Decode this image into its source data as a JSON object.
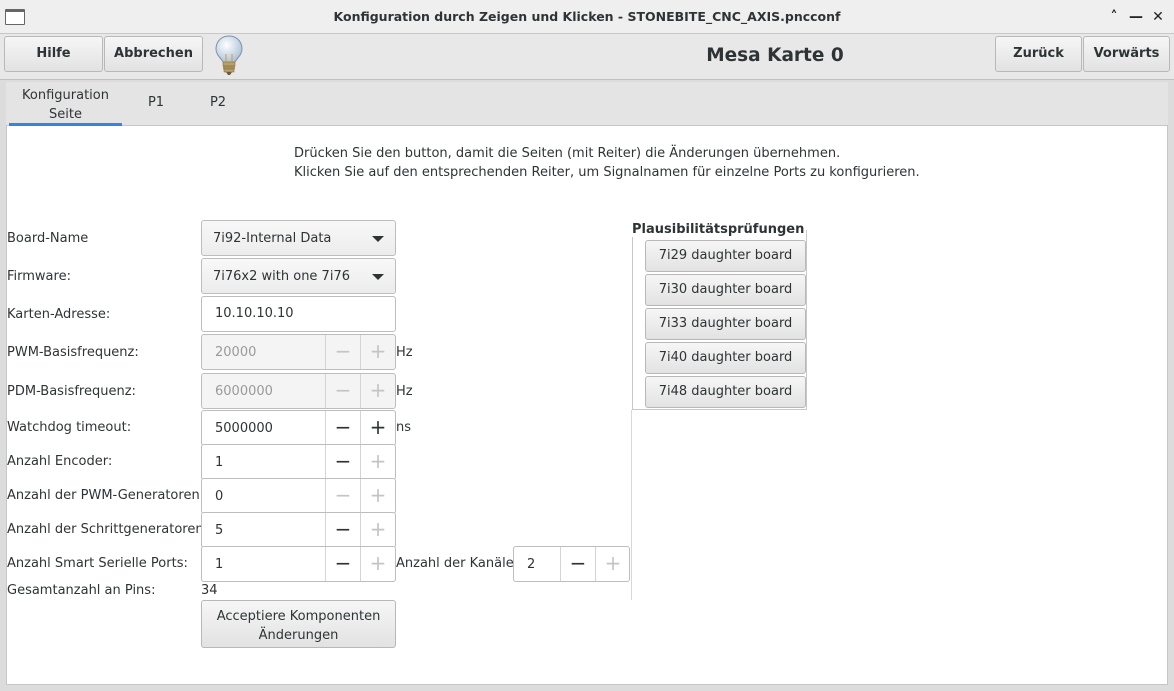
{
  "window": {
    "title": "Konfiguration durch Zeigen und Klicken - STONEBITE_CNC_AXIS.pncconf",
    "controls": {
      "restore": "˄",
      "minimize": "—",
      "close": "✕"
    }
  },
  "toolbar": {
    "help_label": "Hilfe",
    "cancel_label": "Abbrechen",
    "page_title": "Mesa Karte 0",
    "back_label": "Zurück",
    "forward_label": "Vorwärts"
  },
  "tabs": [
    {
      "label_line1": "Konfiguration",
      "label_line2": "Seite",
      "active": true
    },
    {
      "label": "P1",
      "active": false
    },
    {
      "label": "P2",
      "active": false
    }
  ],
  "instructions": {
    "line1": "Drücken Sie den button, damit die Seiten (mit Reiter) die Änderungen übernehmen.",
    "line2": "Klicken Sie auf den entsprechenden Reiter, um Signalnamen für einzelne Ports zu konfigurieren."
  },
  "form": {
    "board_name": {
      "label": "Board-Name",
      "value": "7i92-Internal Data"
    },
    "firmware": {
      "label": "Firmware:",
      "value": "7i76x2 with one 7i76"
    },
    "card_address": {
      "label": "Karten-Adresse:",
      "value": "10.10.10.10"
    },
    "pwm_freq": {
      "label": "PWM-Basisfrequenz:",
      "value": "20000",
      "unit": "Hz"
    },
    "pdm_freq": {
      "label": "PDM-Basisfrequenz:",
      "value": "6000000",
      "unit": "Hz"
    },
    "watchdog": {
      "label": "Watchdog timeout:",
      "value": "5000000",
      "unit": "ns"
    },
    "encoders": {
      "label": "Anzahl Encoder:",
      "value": "1"
    },
    "pwm_generators": {
      "label": "Anzahl der PWM-Generatoren:",
      "value": "0"
    },
    "step_generators": {
      "label": "Anzahl der Schrittgeneratoren:",
      "value": "5"
    },
    "smart_serial": {
      "label": "Anzahl Smart Serielle Ports:",
      "value": "1"
    },
    "channels": {
      "label": "Anzahl der Kanäle:",
      "value": "2"
    },
    "total_pins": {
      "label": "Gesamtanzahl an Pins:",
      "value": "34"
    },
    "accept_line1": "Acceptiere  Komponenten",
    "accept_line2": "Änderungen"
  },
  "sanity": {
    "title": "Plausibilitätsprüfungen",
    "buttons": [
      "7i29 daughter board",
      "7i30 daughter board",
      "7i33 daughter board",
      "7i40 daughter board",
      "7i48 daughter board"
    ]
  },
  "colors": {
    "accent": "#3584e4"
  }
}
